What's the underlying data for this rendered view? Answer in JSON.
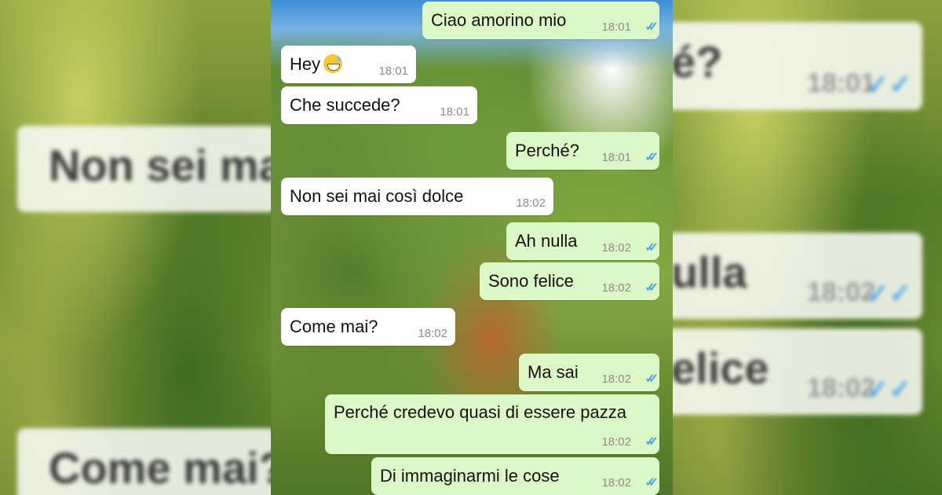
{
  "messages": [
    {
      "dir": "out",
      "text": "Ciao amorino mio",
      "time": "18:01",
      "check": "✓✓"
    },
    {
      "dir": "in",
      "text": "Hey",
      "emoji": "sweat-smile-emoji",
      "time": "18:01"
    },
    {
      "dir": "in",
      "text": "Che succede?",
      "time": "18:01"
    },
    {
      "dir": "out",
      "text": "Perché?",
      "time": "18:01",
      "check": "✓✓"
    },
    {
      "dir": "in",
      "text": "Non sei mai così dolce",
      "time": "18:02"
    },
    {
      "dir": "out",
      "text": "Ah nulla",
      "time": "18:02",
      "check": "✓✓"
    },
    {
      "dir": "out",
      "text": "Sono felice",
      "time": "18:02",
      "check": "✓✓"
    },
    {
      "dir": "in",
      "text": "Come mai?",
      "time": "18:02"
    },
    {
      "dir": "out",
      "text": "Ma sai",
      "time": "18:02",
      "check": "✓✓"
    },
    {
      "dir": "out",
      "text": "Perché credevo quasi di essere pazza",
      "time": "18:02",
      "check": "✓✓"
    },
    {
      "dir": "out",
      "text": "Di immaginarmi le cose",
      "time": "18:02",
      "check": "✓✓"
    }
  ],
  "backdrop_left": [
    {
      "text": "Non sei ma"
    },
    {
      "text": "Come mai?"
    }
  ],
  "backdrop_right": [
    {
      "text": "é?",
      "time": "18:01",
      "check": "✓✓"
    },
    {
      "text": "ulla",
      "time": "18:02",
      "check": "✓✓"
    },
    {
      "text": "elice",
      "time": "18:02",
      "check": "✓✓"
    }
  ],
  "colors": {
    "incoming_bubble": "#ffffff",
    "outgoing_bubble": "#dcf8c6",
    "read_check": "#4fa6e8",
    "timestamp": "#8c8c8c"
  }
}
